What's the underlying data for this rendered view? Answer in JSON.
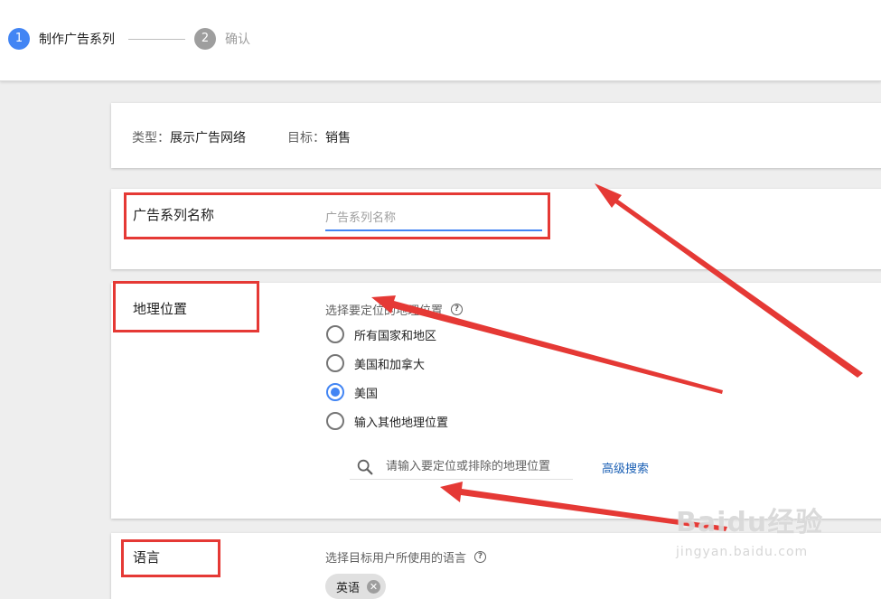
{
  "stepper": {
    "step1": {
      "number": "1",
      "label": "制作广告系列"
    },
    "step2": {
      "number": "2",
      "label": "确认"
    }
  },
  "summary": {
    "type_label": "类型：",
    "type_value": "展示广告网络",
    "goal_label": "目标：",
    "goal_value": "销售"
  },
  "campaign_name": {
    "title": "广告系列名称",
    "placeholder": "广告系列名称",
    "value": ""
  },
  "location": {
    "title": "地理位置",
    "prompt": "选择要定位的地理位置",
    "options": [
      {
        "label": "所有国家和地区",
        "selected": false
      },
      {
        "label": "美国和加拿大",
        "selected": false
      },
      {
        "label": "美国",
        "selected": true
      },
      {
        "label": "输入其他地理位置",
        "selected": false
      }
    ],
    "search_placeholder": "请输入要定位或排除的地理位置",
    "advanced_search": "高级搜索"
  },
  "language": {
    "title": "语言",
    "prompt": "选择目标用户所使用的语言",
    "chip": "英语"
  },
  "icons": {
    "help": "help-icon",
    "search": "search-icon",
    "chip_remove": "close-icon"
  },
  "colors": {
    "accent": "#4285f4",
    "annotation_red": "#e53935",
    "link": "#1a5fb4"
  },
  "watermark": {
    "brand": "Baidu经验",
    "url": "jingyan.baidu.com"
  }
}
